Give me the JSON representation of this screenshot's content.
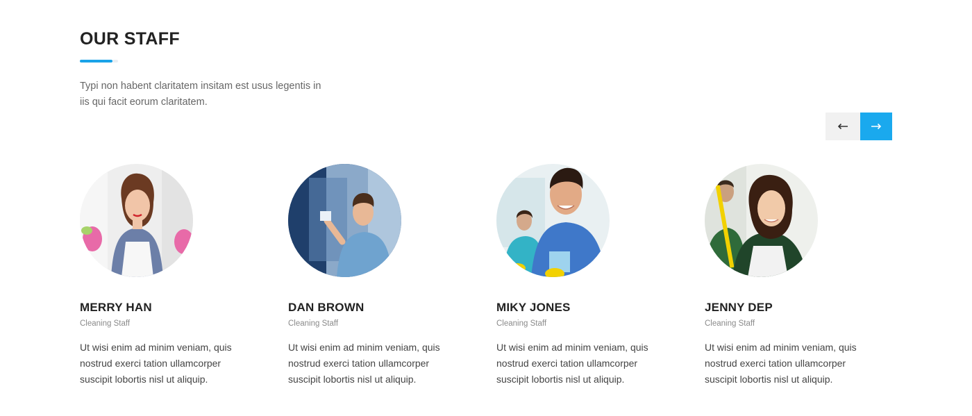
{
  "section": {
    "title": "OUR STAFF",
    "intro": "Typi non habent claritatem insitam est usus legentis in iis qui facit eorum claritatem.",
    "accent_color": "#1aa3e8"
  },
  "carousel": {
    "prev_icon": "arrow-left-icon",
    "next_icon": "arrow-right-icon",
    "next_color": "#1aa9ee"
  },
  "staff": [
    {
      "name": "MERRY HAN",
      "role": "Cleaning Staff",
      "bio": "Ut wisi enim ad minim veniam, quis nostrud exerci tation ullamcorper suscipit lobortis nisl ut aliquip."
    },
    {
      "name": "DAN BROWN",
      "role": "Cleaning Staff",
      "bio": "Ut wisi enim ad minim veniam, quis nostrud exerci tation ullamcorper suscipit lobortis nisl ut aliquip."
    },
    {
      "name": "MIKY JONES",
      "role": "Cleaning Staff",
      "bio": "Ut wisi enim ad minim veniam, quis nostrud exerci tation ullamcorper suscipit lobortis nisl ut aliquip."
    },
    {
      "name": "JENNY DEP",
      "role": "Cleaning Staff",
      "bio": "Ut wisi enim ad minim veniam, quis nostrud exerci tation ullamcorper suscipit lobortis nisl ut aliquip."
    }
  ]
}
